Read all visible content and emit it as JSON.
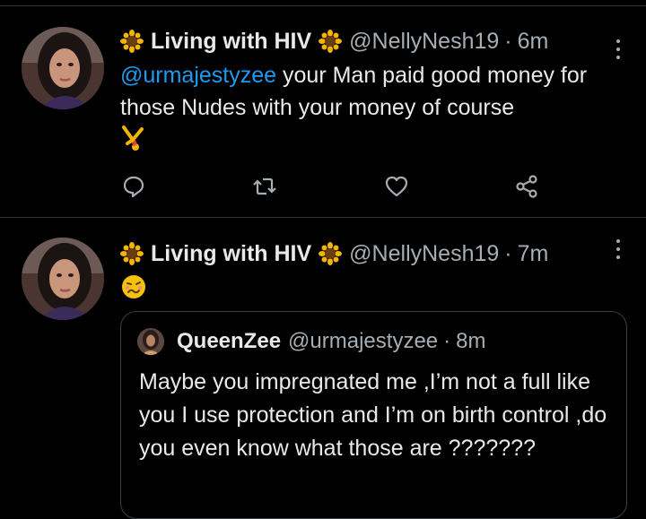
{
  "tweets": [
    {
      "display_name": "Living with HIV",
      "handle": "@NellyNesh19",
      "separator": "·",
      "time": "6m",
      "mention": "@urmajestyzee",
      "text": " your Man paid good money for those Nudes with your money of course",
      "emoji": "cartwheel-emoji"
    },
    {
      "display_name": "Living with HIV",
      "handle": "@NellyNesh19",
      "separator": "·",
      "time": "7m",
      "emoji": "woozy-face-emoji",
      "quote": {
        "display_name": "QueenZee",
        "handle": "@urmajestyzee",
        "separator": "·",
        "time": "8m",
        "text": "Maybe you impregnated me ,I’m not a full like you I use protection and I’m on birth control ,do you even know what those are ???????"
      }
    }
  ],
  "icons": {
    "name_decoration": "sunflower-icon",
    "reply": "reply-icon",
    "retweet": "retweet-icon",
    "like": "heart-icon",
    "share": "share-icon",
    "more": "more-icon"
  },
  "colors": {
    "background": "#000000",
    "text": "#e7e9ea",
    "secondary_text": "#a6adb3",
    "link": "#1d9bf0",
    "divider": "#2f3336"
  }
}
